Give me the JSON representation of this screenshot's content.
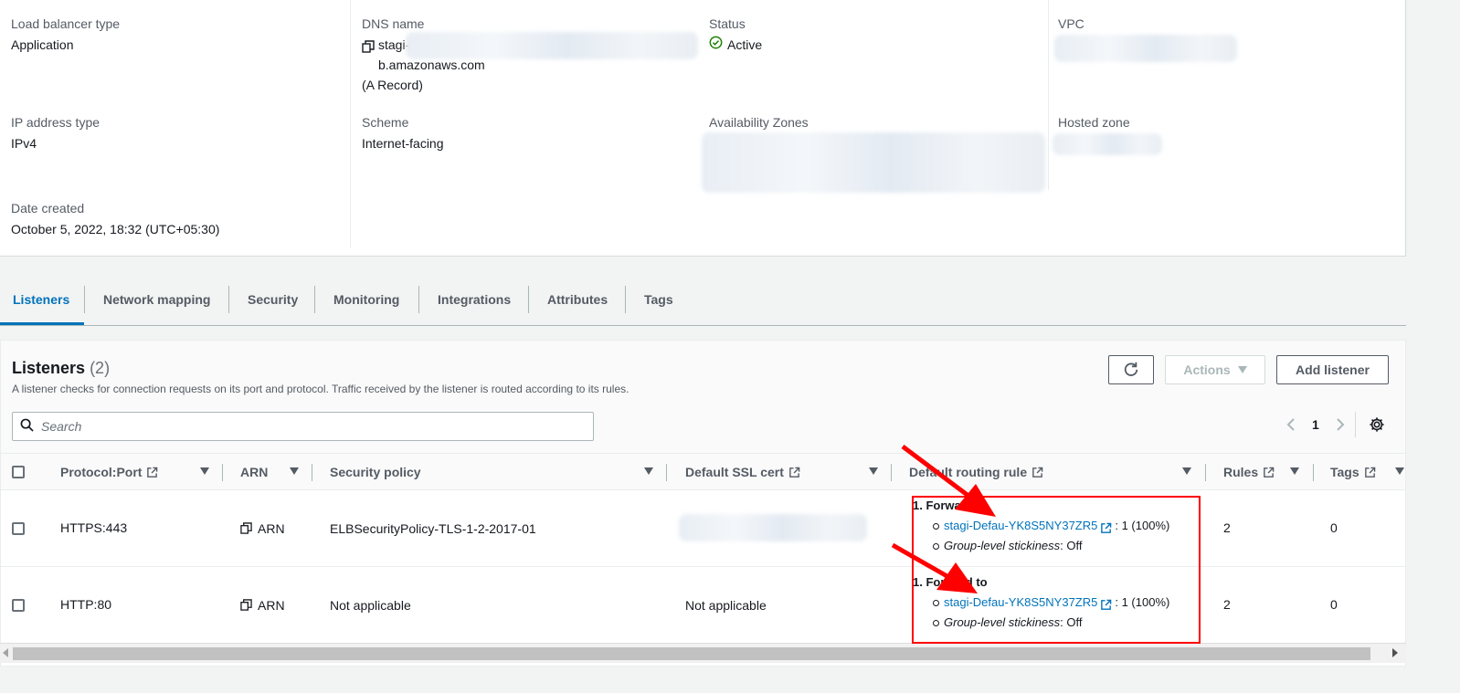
{
  "details": {
    "load_balancer_type": {
      "label": "Load balancer type",
      "value": "Application"
    },
    "dns_name": {
      "label": "DNS name",
      "prefix": "stagi-",
      "suffix": "b.amazonaws.com",
      "record": "(A Record)"
    },
    "status": {
      "label": "Status",
      "value": "Active"
    },
    "vpc": {
      "label": "VPC"
    },
    "ip_address_type": {
      "label": "IP address type",
      "value": "IPv4"
    },
    "scheme": {
      "label": "Scheme",
      "value": "Internet-facing"
    },
    "availability_zones": {
      "label": "Availability Zones"
    },
    "hosted_zone": {
      "label": "Hosted zone"
    },
    "date_created": {
      "label": "Date created",
      "value": "October 5, 2022, 18:32 (UTC+05:30)"
    }
  },
  "tabs": [
    "Listeners",
    "Network mapping",
    "Security",
    "Monitoring",
    "Integrations",
    "Attributes",
    "Tags"
  ],
  "listeners": {
    "title": "Listeners",
    "count": "(2)",
    "description": "A listener checks for connection requests on its port and protocol. Traffic received by the listener is routed according to its rules.",
    "actions_label": "Actions",
    "add_label": "Add listener",
    "search_placeholder": "Search",
    "page": "1",
    "columns": {
      "protocol_port": "Protocol:Port",
      "arn": "ARN",
      "security_policy": "Security policy",
      "ssl_cert": "Default SSL cert",
      "routing_rule": "Default routing rule",
      "rules": "Rules",
      "tags": "Tags"
    },
    "rows": [
      {
        "protocol_port": "HTTPS:443",
        "arn": "ARN",
        "security_policy": "ELBSecurityPolicy-TLS-1-2-2017-01",
        "ssl_cert": "",
        "rule_header": "1. Forward to",
        "target": "stagi-Defau-YK8S5NY37ZR5",
        "weight": ": 1 (100%)",
        "stickiness_label": "Group-level stickiness",
        "stickiness_value": ": Off",
        "rules": "2",
        "tags": "0"
      },
      {
        "protocol_port": "HTTP:80",
        "arn": "ARN",
        "security_policy": "Not applicable",
        "ssl_cert": "Not applicable",
        "rule_header": "1. Forward to",
        "target": "stagi-Defau-YK8S5NY37ZR5",
        "weight": ": 1 (100%)",
        "stickiness_label": "Group-level stickiness",
        "stickiness_value": ": Off",
        "rules": "2",
        "tags": "0"
      }
    ]
  },
  "colors": {
    "link": "#0073bb",
    "status_ok": "#1d8102",
    "annotation": "#ff0000"
  }
}
